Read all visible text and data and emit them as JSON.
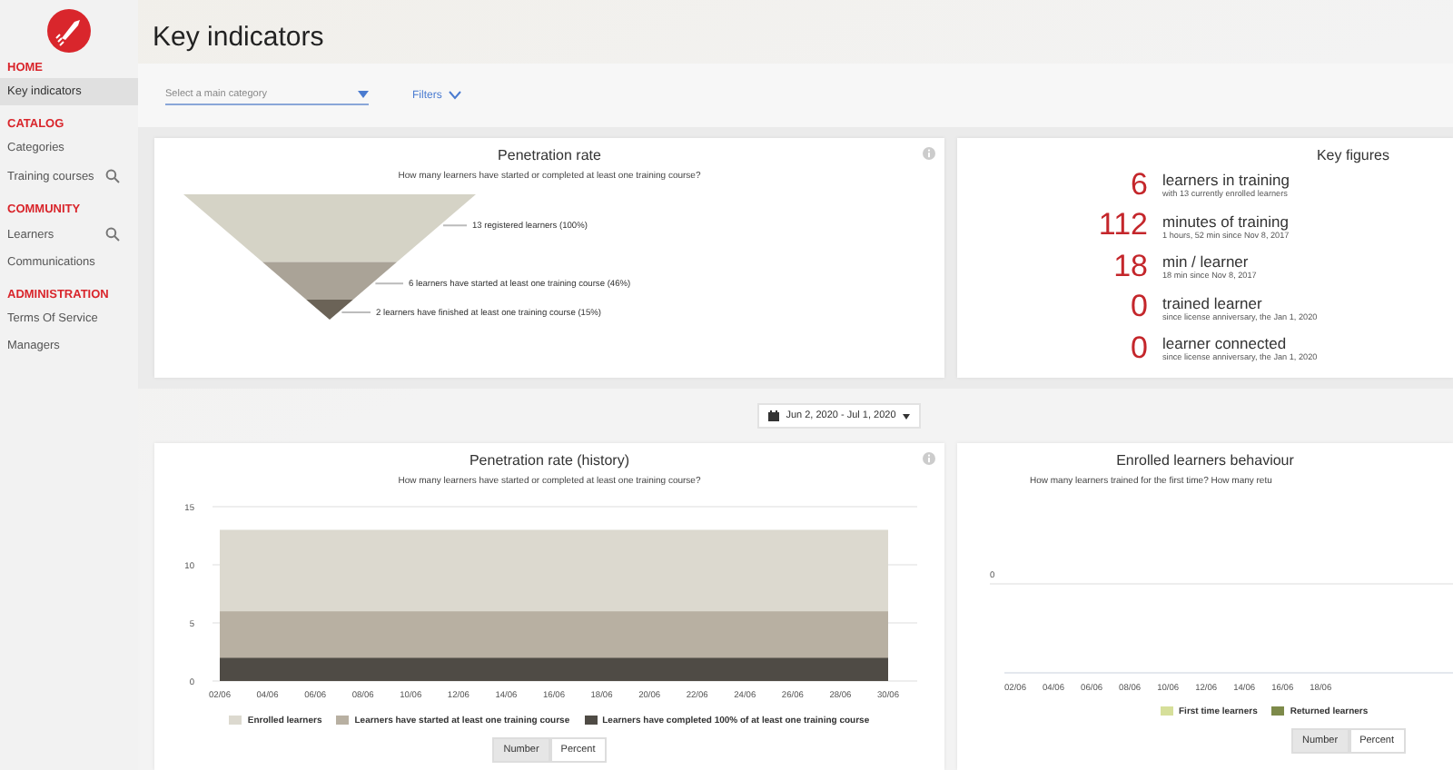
{
  "page_title": "Key indicators",
  "sidebar": {
    "sections": [
      {
        "title": "HOME",
        "items": [
          {
            "label": "Key indicators",
            "selected": true,
            "has_search": false
          }
        ]
      },
      {
        "title": "CATALOG",
        "items": [
          {
            "label": "Categories",
            "selected": false,
            "has_search": false
          },
          {
            "label": "Training courses",
            "selected": false,
            "has_search": true
          }
        ]
      },
      {
        "title": "COMMUNITY",
        "items": [
          {
            "label": "Learners",
            "selected": false,
            "has_search": true
          },
          {
            "label": "Communications",
            "selected": false,
            "has_search": false
          }
        ]
      },
      {
        "title": "ADMINISTRATION",
        "items": [
          {
            "label": "Terms Of Service",
            "selected": false,
            "has_search": false
          },
          {
            "label": "Managers",
            "selected": false,
            "has_search": false
          }
        ]
      }
    ]
  },
  "filters": {
    "category_select": {
      "placeholder": "Select a main category"
    },
    "filters_button": "Filters"
  },
  "penetration_card": {
    "title": "Penetration rate",
    "subtitle": "How many learners have started or completed at least one training course?",
    "stages": [
      {
        "label": "13 registered learners (100%)",
        "color": "#d5d3c6"
      },
      {
        "label": "6 learners have started at least one training course (46%)",
        "color": "#aaa397"
      },
      {
        "label": "2 learners have finished at least one training course (15%)",
        "color": "#6b6357"
      }
    ]
  },
  "key_figures": {
    "title": "Key figures",
    "items": [
      {
        "value": "6",
        "label": "learners in training",
        "detail": "with 13 currently enrolled learners"
      },
      {
        "value": "112",
        "label": "minutes of training",
        "detail": "1 hours, 52 min since Nov 8, 2017"
      },
      {
        "value": "18",
        "label": "min / learner",
        "detail": "18 min since Nov 8, 2017"
      },
      {
        "value": "0",
        "label": "trained learner",
        "detail": "since license anniversary, the Jan 1, 2020"
      },
      {
        "value": "0",
        "label": "learner connected",
        "detail": "since license anniversary, the Jan 1, 2020"
      }
    ]
  },
  "date_range": "Jun 2, 2020 - Jul 1, 2020",
  "history_card": {
    "title": "Penetration rate (history)",
    "subtitle": "How many learners have started or completed at least one training course?",
    "chart_data": {
      "type": "area",
      "categories": [
        "02/06",
        "04/06",
        "06/06",
        "08/06",
        "10/06",
        "12/06",
        "14/06",
        "16/06",
        "18/06",
        "20/06",
        "22/06",
        "24/06",
        "26/06",
        "28/06",
        "30/06"
      ],
      "ylim": [
        0,
        15
      ],
      "yticks": [
        0,
        5,
        10,
        15
      ],
      "stacked": false,
      "series": [
        {
          "name": "Enrolled learners",
          "color": "#dcd9cf",
          "values": [
            13,
            13,
            13,
            13,
            13,
            13,
            13,
            13,
            13,
            13,
            13,
            13,
            13,
            13,
            13
          ]
        },
        {
          "name": "Learners have started at least one training course",
          "color": "#b8b0a2",
          "values": [
            6,
            6,
            6,
            6,
            6,
            6,
            6,
            6,
            6,
            6,
            6,
            6,
            6,
            6,
            6
          ]
        },
        {
          "name": "Learners have completed 100% of at least one training course",
          "color": "#4f4b45",
          "values": [
            2,
            2,
            2,
            2,
            2,
            2,
            2,
            2,
            2,
            2,
            2,
            2,
            2,
            2,
            2
          ]
        }
      ]
    },
    "toggle": [
      {
        "label": "Number",
        "selected": true
      },
      {
        "label": "Percent",
        "selected": false
      }
    ]
  },
  "behaviour_card": {
    "title": "Enrolled learners behaviour",
    "subtitle": "How many learners trained for the first time? How many retu",
    "y_axis_labels": [
      "0"
    ],
    "x_axis_labels": [
      "02/06",
      "04/06",
      "06/06",
      "08/06",
      "10/06",
      "12/06",
      "14/06",
      "16/06",
      "18/06"
    ],
    "legend": [
      {
        "label": "First time learners",
        "color": "#d6df9a"
      },
      {
        "label": "Returned learners",
        "color": "#7d8a4a"
      }
    ],
    "toggle": [
      {
        "label": "Number",
        "selected": true
      },
      {
        "label": "Percent",
        "selected": false
      }
    ]
  }
}
